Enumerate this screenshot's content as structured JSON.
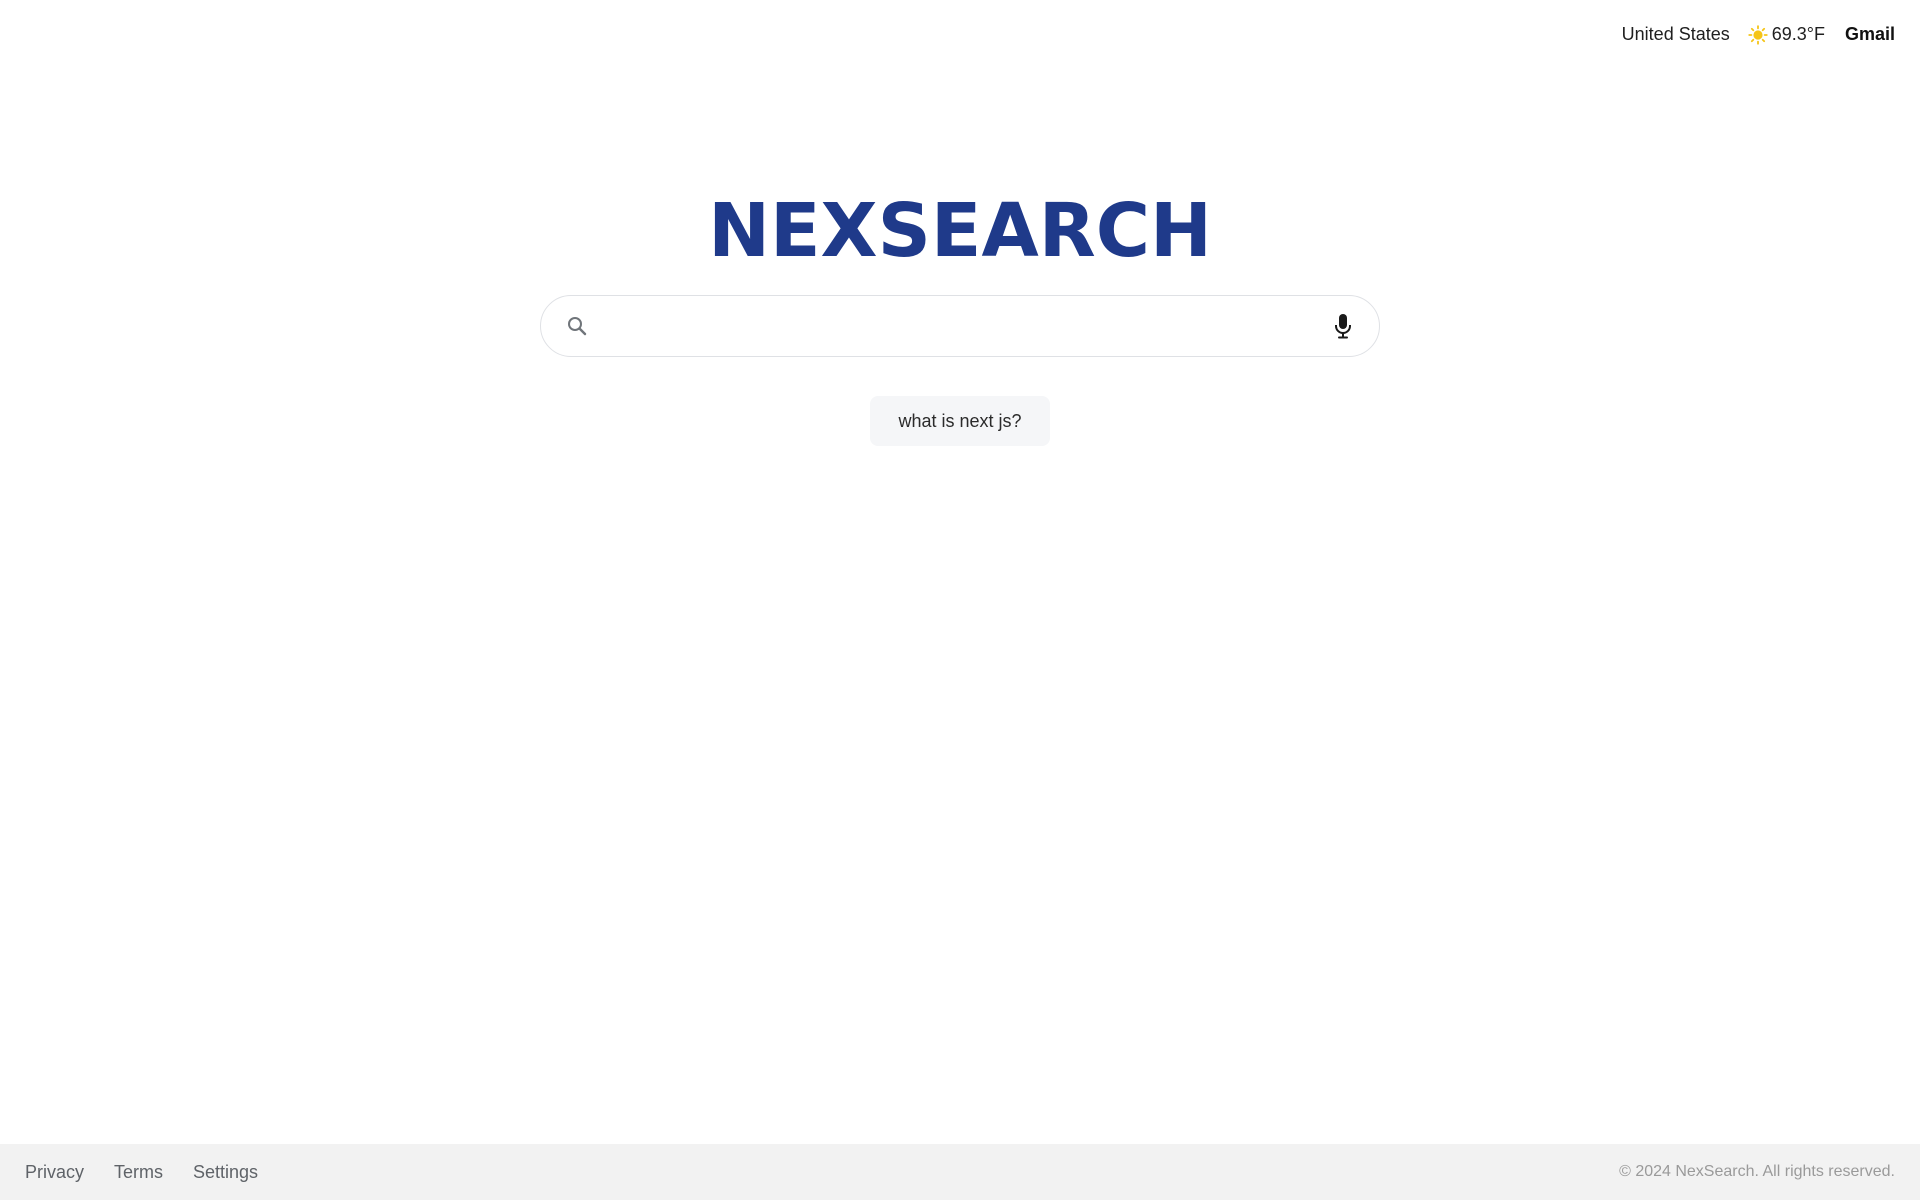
{
  "header": {
    "country": "United States",
    "weather": {
      "icon": "sun-icon",
      "temperature": "69.3°F",
      "icon_color": "#f5c518"
    },
    "gmail_label": "Gmail"
  },
  "logo": {
    "text": "NEXSEARCH",
    "color": "#1f3a8a"
  },
  "search": {
    "value": "",
    "placeholder": "",
    "search_icon": "search-icon",
    "mic_icon": "microphone-icon"
  },
  "suggestions": [
    {
      "label": "what is next js?"
    }
  ],
  "footer": {
    "links": [
      {
        "label": "Privacy"
      },
      {
        "label": "Terms"
      },
      {
        "label": "Settings"
      }
    ],
    "copyright": "© 2024 NexSearch. All rights reserved."
  }
}
